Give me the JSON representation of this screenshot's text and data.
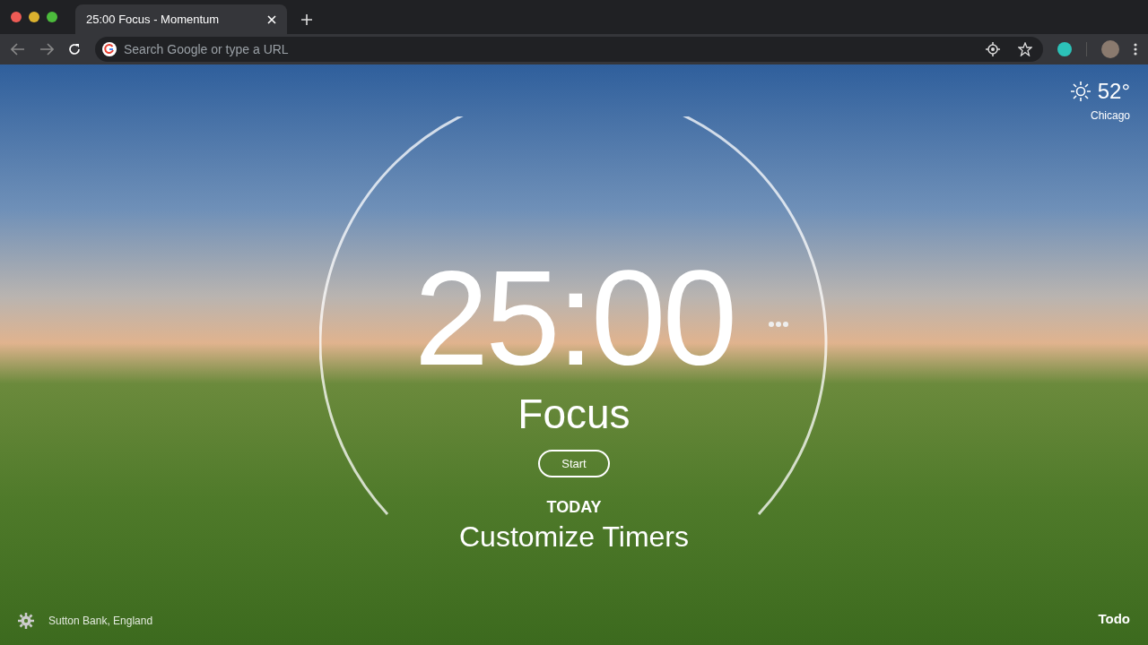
{
  "browser": {
    "tab": {
      "title": "25:00 Focus - Momentum"
    },
    "address_bar": {
      "placeholder": "Search Google or type a URL"
    }
  },
  "weather": {
    "temperature": "52°",
    "location": "Chicago"
  },
  "timer": {
    "time": "25:00",
    "mode": "Focus",
    "start_button": "Start"
  },
  "focus": {
    "heading": "TODAY",
    "text": "Customize Timers"
  },
  "footer": {
    "photo_location": "Sutton Bank, England",
    "todo": "Todo"
  }
}
